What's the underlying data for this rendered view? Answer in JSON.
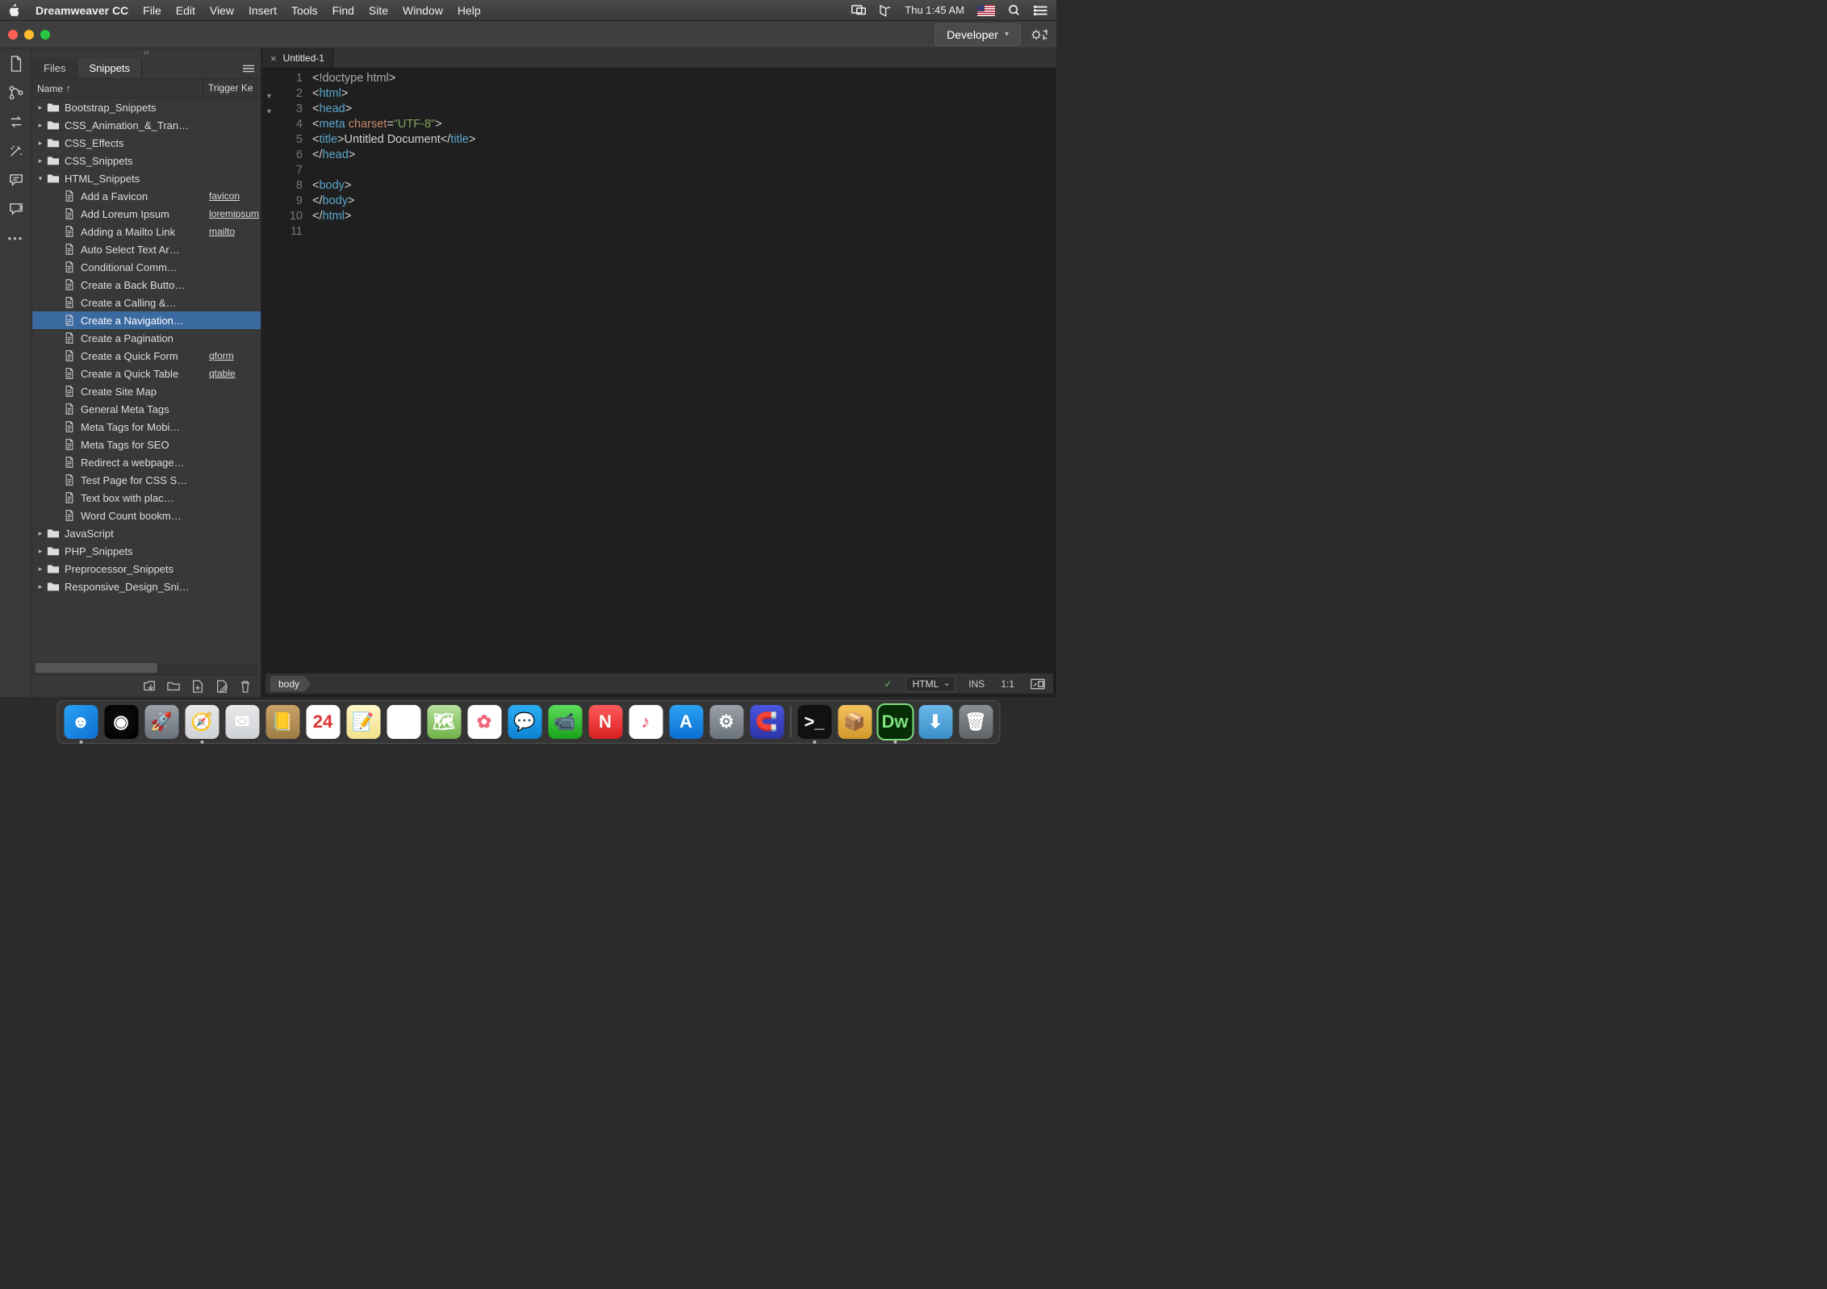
{
  "menubar": {
    "appname": "Dreamweaver CC",
    "items": [
      "File",
      "Edit",
      "View",
      "Insert",
      "Tools",
      "Find",
      "Site",
      "Window",
      "Help"
    ],
    "clock": "Thu 1:45 AM"
  },
  "titlebar": {
    "workspace_label": "Developer"
  },
  "panel": {
    "collapse_glyph": "‹‹",
    "tabs": {
      "files": "Files",
      "snippets": "Snippets"
    },
    "columns": {
      "name": "Name",
      "sort_arrow": "↑",
      "trigger": "Trigger Ke"
    },
    "folders": [
      {
        "name": "Bootstrap_Snippets",
        "expanded": false
      },
      {
        "name": "CSS_Animation_&_Tran…",
        "expanded": false
      },
      {
        "name": "CSS_Effects",
        "expanded": false
      },
      {
        "name": "CSS_Snippets",
        "expanded": false
      },
      {
        "name": "HTML_Snippets",
        "expanded": true,
        "children": [
          {
            "name": "Add a Favicon",
            "trigger": "favicon"
          },
          {
            "name": "Add Loreum Ipsum",
            "trigger": "loremipsum"
          },
          {
            "name": "Adding a Mailto Link",
            "trigger": "mailto"
          },
          {
            "name": "Auto Select Text Ar…"
          },
          {
            "name": "Conditional Comm…"
          },
          {
            "name": "Create a Back Butto…"
          },
          {
            "name": "Create a Calling &…"
          },
          {
            "name": "Create a Navigation…",
            "selected": true
          },
          {
            "name": "Create a Pagination"
          },
          {
            "name": "Create a Quick Form",
            "trigger": "qform"
          },
          {
            "name": "Create a Quick Table",
            "trigger": "qtable"
          },
          {
            "name": "Create Site Map"
          },
          {
            "name": "General Meta Tags"
          },
          {
            "name": "Meta Tags for Mobi…"
          },
          {
            "name": "Meta Tags for SEO"
          },
          {
            "name": "Redirect a webpage…"
          },
          {
            "name": "Test Page for CSS S…"
          },
          {
            "name": "Text box with plac…"
          },
          {
            "name": "Word Count bookm…"
          }
        ]
      },
      {
        "name": "JavaScript",
        "expanded": false
      },
      {
        "name": "PHP_Snippets",
        "expanded": false
      },
      {
        "name": "Preprocessor_Snippets",
        "expanded": false
      },
      {
        "name": "Responsive_Design_Sni…",
        "expanded": false
      }
    ]
  },
  "editor": {
    "tab_title": "Untitled-1",
    "code": [
      {
        "n": 1,
        "fold": false,
        "html": "<span class='c-punct'>&lt;</span><span class='c-grey'>!doctype html</span><span class='c-punct'>&gt;</span>"
      },
      {
        "n": 2,
        "fold": true,
        "html": "<span class='c-punct'>&lt;</span><span class='c-tag'>html</span><span class='c-punct'>&gt;</span>"
      },
      {
        "n": 3,
        "fold": true,
        "html": "<span class='c-punct'>&lt;</span><span class='c-tag'>head</span><span class='c-punct'>&gt;</span>"
      },
      {
        "n": 4,
        "fold": false,
        "html": "<span class='c-punct'>&lt;</span><span class='c-tag'>meta</span> <span class='c-attr'>charset</span><span class='c-punct'>=</span><span class='c-str'>\"UTF-8\"</span><span class='c-punct'>&gt;</span>"
      },
      {
        "n": 5,
        "fold": false,
        "html": "<span class='c-punct'>&lt;</span><span class='c-tag'>title</span><span class='c-punct'>&gt;</span>Untitled Document<span class='c-punct'>&lt;/</span><span class='c-tag'>title</span><span class='c-punct'>&gt;</span>"
      },
      {
        "n": 6,
        "fold": false,
        "html": "<span class='c-punct'>&lt;/</span><span class='c-tag'>head</span><span class='c-punct'>&gt;</span>"
      },
      {
        "n": 7,
        "fold": false,
        "html": ""
      },
      {
        "n": 8,
        "fold": false,
        "html": "<span class='c-punct'>&lt;</span><span class='c-tag'>body</span><span class='c-punct'>&gt;</span>"
      },
      {
        "n": 9,
        "fold": false,
        "html": "<span class='c-punct'>&lt;/</span><span class='c-tag'>body</span><span class='c-punct'>&gt;</span>"
      },
      {
        "n": 10,
        "fold": false,
        "html": "<span class='c-punct'>&lt;/</span><span class='c-tag'>html</span><span class='c-punct'>&gt;</span>"
      },
      {
        "n": 11,
        "fold": false,
        "html": ""
      }
    ]
  },
  "status": {
    "breadcrumb": "body",
    "lang": "HTML",
    "ins": "INS",
    "cursor": "1:1"
  },
  "dock": {
    "apps": [
      {
        "name": "finder",
        "bg": "linear-gradient(135deg,#2aa3f4,#0d6fd1)",
        "glyph": "☻",
        "running": true
      },
      {
        "name": "siri",
        "bg": "radial-gradient(circle,#111,#000)",
        "glyph": "◉"
      },
      {
        "name": "launchpad",
        "bg": "linear-gradient(#9aa1a8,#6c7279)",
        "glyph": "🚀"
      },
      {
        "name": "safari",
        "bg": "linear-gradient(#e8e8ea,#cfd2d6)",
        "glyph": "🧭",
        "running": true
      },
      {
        "name": "mail",
        "bg": "linear-gradient(#e8e8ea,#cfd2d6)",
        "glyph": "✉"
      },
      {
        "name": "contacts",
        "bg": "linear-gradient(#caa26a,#a07b45)",
        "glyph": "📒"
      },
      {
        "name": "calendar",
        "bg": "#fff",
        "glyph": "24",
        "text": "#d33"
      },
      {
        "name": "notes",
        "bg": "linear-gradient(#fff7c9,#f1e28a)",
        "glyph": "📝"
      },
      {
        "name": "reminders",
        "bg": "#fff",
        "glyph": "☑"
      },
      {
        "name": "maps",
        "bg": "linear-gradient(#b7e09d,#6fb24a)",
        "glyph": "🗺"
      },
      {
        "name": "photos",
        "bg": "#fff",
        "glyph": "✿",
        "text": "#e67"
      },
      {
        "name": "messages",
        "bg": "linear-gradient(#2aaef5,#0d82d1)",
        "glyph": "💬"
      },
      {
        "name": "facetime",
        "bg": "linear-gradient(#5cdc5c,#19a319)",
        "glyph": "📹"
      },
      {
        "name": "news",
        "bg": "linear-gradient(#ff5a5a,#d91f1f)",
        "glyph": "N"
      },
      {
        "name": "itunes",
        "bg": "#fff",
        "glyph": "♪",
        "text": "#e46"
      },
      {
        "name": "appstore",
        "bg": "linear-gradient(#2aa3f4,#0d6fd1)",
        "glyph": "A"
      },
      {
        "name": "sysprefs",
        "bg": "linear-gradient(#9aa1a8,#6c7279)",
        "glyph": "⚙"
      },
      {
        "name": "magnet",
        "bg": "linear-gradient(#4a55e2,#2b34a5)",
        "glyph": "🧲"
      }
    ],
    "apps_right": [
      {
        "name": "terminal",
        "bg": "#111",
        "glyph": ">_",
        "running": true
      },
      {
        "name": "package",
        "bg": "linear-gradient(#f4c15c,#d29a2b)",
        "glyph": "📦"
      },
      {
        "name": "dreamweaver",
        "bg": "#062d06",
        "glyph": "Dw",
        "text": "#7fe07f",
        "running": true,
        "outline": "#7fe07f"
      },
      {
        "name": "downloads",
        "bg": "linear-gradient(#6bb7e8,#3a8fc8)",
        "glyph": "⬇"
      },
      {
        "name": "trash",
        "bg": "linear-gradient(#8a8f93,#5e6367)",
        "glyph": "🗑"
      }
    ]
  }
}
